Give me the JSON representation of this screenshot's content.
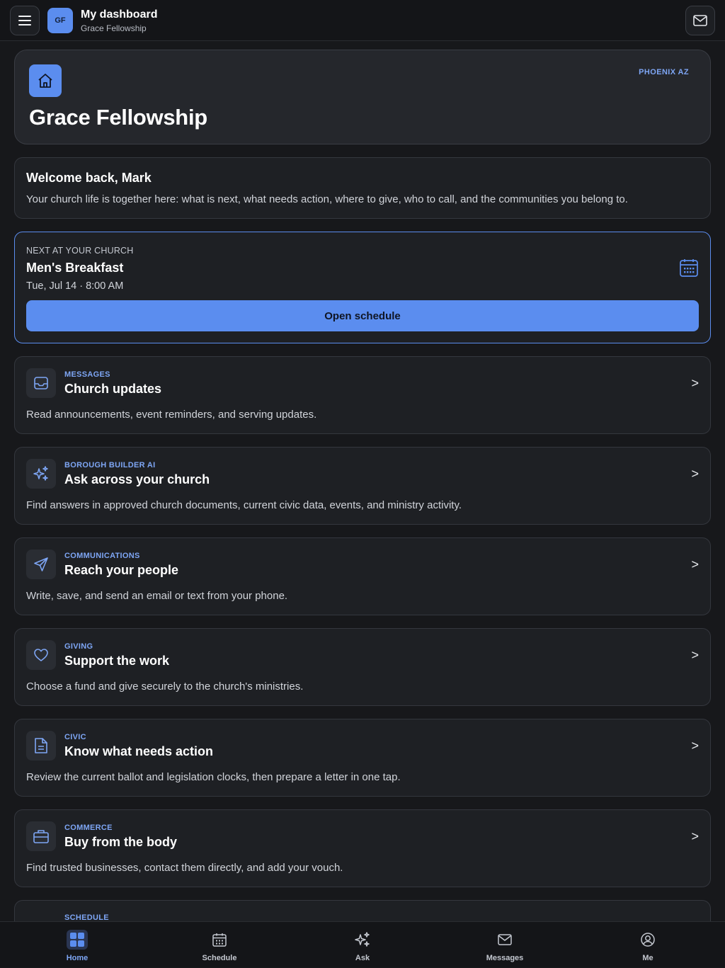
{
  "header": {
    "title": "My dashboard",
    "subtitle": "Grace Fellowship",
    "avatar_initials": "GF",
    "menu_icon": "hamburger-menu-icon",
    "mail_icon": "mail-icon"
  },
  "hero": {
    "icon": "home-icon",
    "location": "PHOENIX AZ",
    "title": "Grace Fellowship"
  },
  "welcome": {
    "title": "Welcome back, Mark",
    "text": "Your church life is together here: what is next, what needs action, where to give, who to call, and the communities you belong to."
  },
  "next": {
    "kicker": "NEXT AT YOUR CHURCH",
    "title": "Men's Breakfast",
    "date": "Tue, Jul 14 · 8:00 AM",
    "icon": "calendar-icon",
    "button_label": "Open schedule"
  },
  "features": [
    {
      "kicker": "MESSAGES",
      "title": "Church updates",
      "desc": "Read announcements, event reminders, and serving updates.",
      "icon": "inbox-icon",
      "chevron": ">"
    },
    {
      "kicker": "BOROUGH BUILDER AI",
      "title": "Ask across your church",
      "desc": "Find answers in approved church documents, current civic data, events, and ministry activity.",
      "icon": "sparkles-icon",
      "chevron": ">"
    },
    {
      "kicker": "COMMUNICATIONS",
      "title": "Reach your people",
      "desc": "Write, save, and send an email or text from your phone.",
      "icon": "send-icon",
      "chevron": ">"
    },
    {
      "kicker": "GIVING",
      "title": "Support the work",
      "desc": "Choose a fund and give securely to the church's ministries.",
      "icon": "heart-icon",
      "chevron": ">"
    },
    {
      "kicker": "CIVIC",
      "title": "Know what needs action",
      "desc": "Review the current ballot and legislation clocks, then prepare a letter in one tap.",
      "icon": "document-icon",
      "chevron": ">"
    },
    {
      "kicker": "COMMERCE",
      "title": "Buy from the body",
      "desc": "Find trusted businesses, contact them directly, and add your vouch.",
      "icon": "briefcase-icon",
      "chevron": ">"
    }
  ],
  "partial_card": {
    "kicker": "SCHEDULE"
  },
  "nav": [
    {
      "label": "Home",
      "icon": "grid-icon",
      "active": true
    },
    {
      "label": "Schedule",
      "icon": "calendar-icon",
      "active": false
    },
    {
      "label": "Ask",
      "icon": "sparkles-icon",
      "active": false
    },
    {
      "label": "Messages",
      "icon": "mail-icon",
      "active": false
    },
    {
      "label": "Me",
      "icon": "user-circle-icon",
      "active": false
    }
  ],
  "colors": {
    "accent": "#5b8def",
    "accent_text": "#7ea6f5",
    "background": "#17181b",
    "card": "#1e2024"
  }
}
